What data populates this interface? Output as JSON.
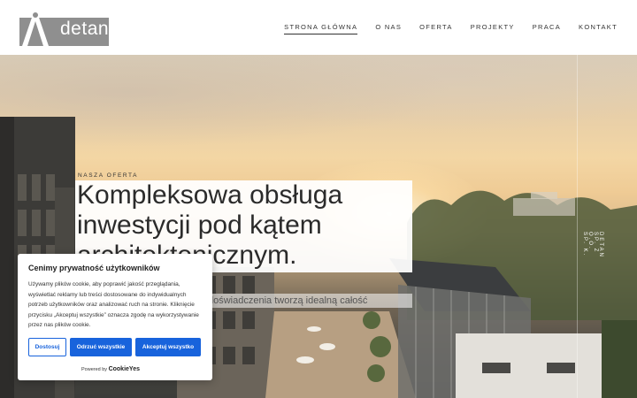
{
  "brand": {
    "name": "detan"
  },
  "nav": {
    "items": [
      {
        "label": "STRONA GŁÓWNA",
        "active": true
      },
      {
        "label": "O NAS",
        "active": false
      },
      {
        "label": "OFERTA",
        "active": false
      },
      {
        "label": "PROJEKTY",
        "active": false
      },
      {
        "label": "PRACA",
        "active": false
      },
      {
        "label": "KONTAKT",
        "active": false
      }
    ]
  },
  "hero": {
    "kicker": "NASZA OFERTA",
    "title_lines": [
      "Kompleksowa obsługa",
      "inwestycji pod kątem",
      "architektonicznym."
    ],
    "subtitle": "doświadczenia tworzą idealną całość",
    "side_text": "DETAN SP. Z O.O. SP. K."
  },
  "cookie": {
    "title": "Cenimy prywatność użytkowników",
    "text": "Używamy plików cookie, aby poprawić jakość przeglądania, wyświetlać reklamy lub treści dostosowane do indywidualnych potrzeb użytkowników oraz analizować ruch na stronie. Kliknięcie przycisku „Akceptuj wszystkie” oznacza zgodę na wykorzystywanie przez nas plików cookie.",
    "btn_customize": "Dostosuj",
    "btn_reject": "Odrzuć wszystkie",
    "btn_accept": "Akceptuj wszystko",
    "powered_label": "Powered by",
    "powered_brand": "CookieYes"
  },
  "colors": {
    "accent": "#1863dc",
    "logo_bg": "#8f8f8f"
  }
}
